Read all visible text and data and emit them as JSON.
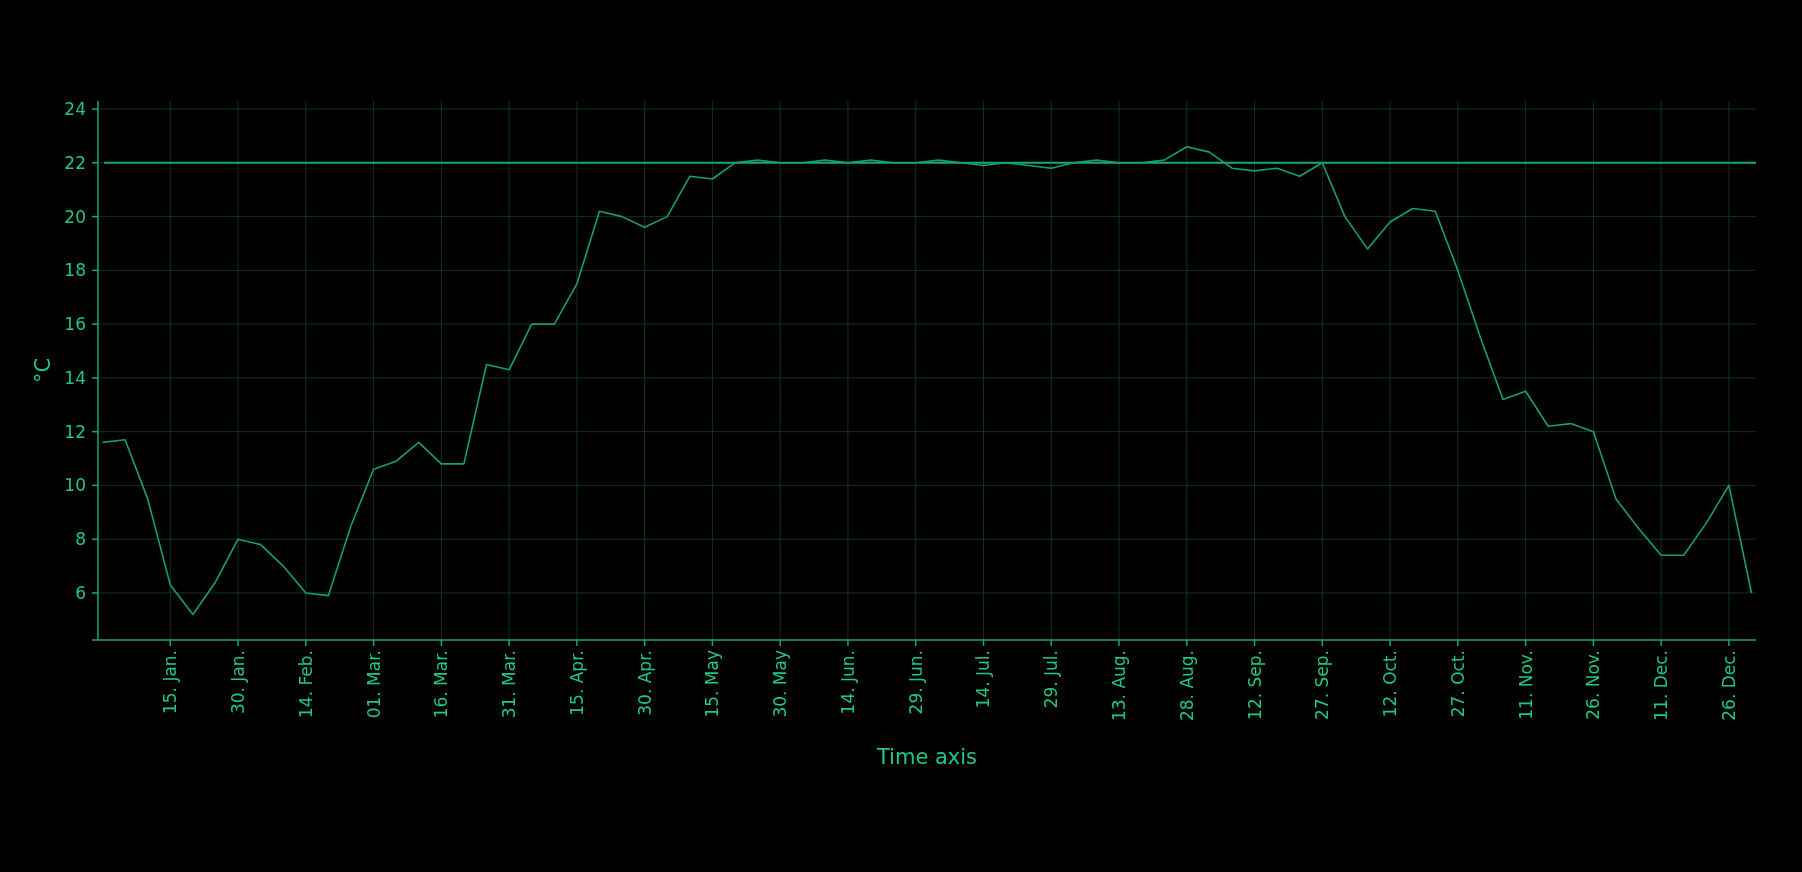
{
  "chart_data": {
    "type": "line",
    "xlabel": "Time axis",
    "ylabel": "°C",
    "categories": [
      null,
      null,
      null,
      "15. Jan.",
      null,
      null,
      "30. Jan.",
      null,
      null,
      "14. Feb.",
      null,
      null,
      "01. Mar.",
      null,
      null,
      "16. Mar.",
      null,
      null,
      "31. Mar.",
      null,
      null,
      "15. Apr.",
      null,
      null,
      "30. Apr.",
      null,
      null,
      "15. May",
      null,
      null,
      "30. May",
      null,
      null,
      "14. Jun.",
      null,
      null,
      "29. Jun.",
      null,
      null,
      "14. Jul.",
      null,
      null,
      "29. Jul.",
      null,
      null,
      "13. Aug.",
      null,
      null,
      "28. Aug.",
      null,
      null,
      "12. Sep.",
      null,
      null,
      "27. Sep.",
      null,
      null,
      "12. Oct.",
      null,
      null,
      "27. Oct.",
      null,
      null,
      "11. Nov.",
      null,
      null,
      "26. Nov.",
      null,
      null,
      "11. Dec.",
      null,
      null,
      "26. Dec.",
      null
    ],
    "values": [
      11.6,
      11.7,
      9.5,
      6.3,
      5.2,
      6.4,
      8.0,
      7.8,
      7.0,
      6.0,
      5.9,
      8.5,
      10.6,
      10.9,
      11.6,
      10.8,
      10.8,
      14.5,
      14.3,
      16.0,
      16.0,
      17.5,
      20.2,
      20.0,
      19.6,
      20.0,
      21.5,
      21.4,
      22.0,
      22.1,
      22.0,
      22.0,
      22.1,
      22.0,
      22.1,
      22.0,
      22.0,
      22.1,
      22.0,
      21.9,
      22.0,
      21.9,
      21.8,
      22.0,
      22.1,
      22.0,
      22.0,
      22.1,
      22.6,
      22.4,
      21.8,
      21.7,
      21.8,
      21.5,
      22.0,
      20.0,
      18.8,
      19.8,
      20.3,
      20.2,
      18.0,
      15.5,
      13.2,
      13.5,
      12.2,
      12.3,
      12.0,
      9.5,
      8.4,
      7.4,
      7.4,
      8.6,
      10.0,
      6.0
    ],
    "ylim": [
      4.25,
      24.3
    ],
    "yticks": [
      6,
      8,
      10,
      12,
      14,
      16,
      18,
      20,
      22,
      24
    ],
    "grid": true,
    "ref_lines": [
      {
        "axis": "y",
        "value": 22
      }
    ]
  }
}
